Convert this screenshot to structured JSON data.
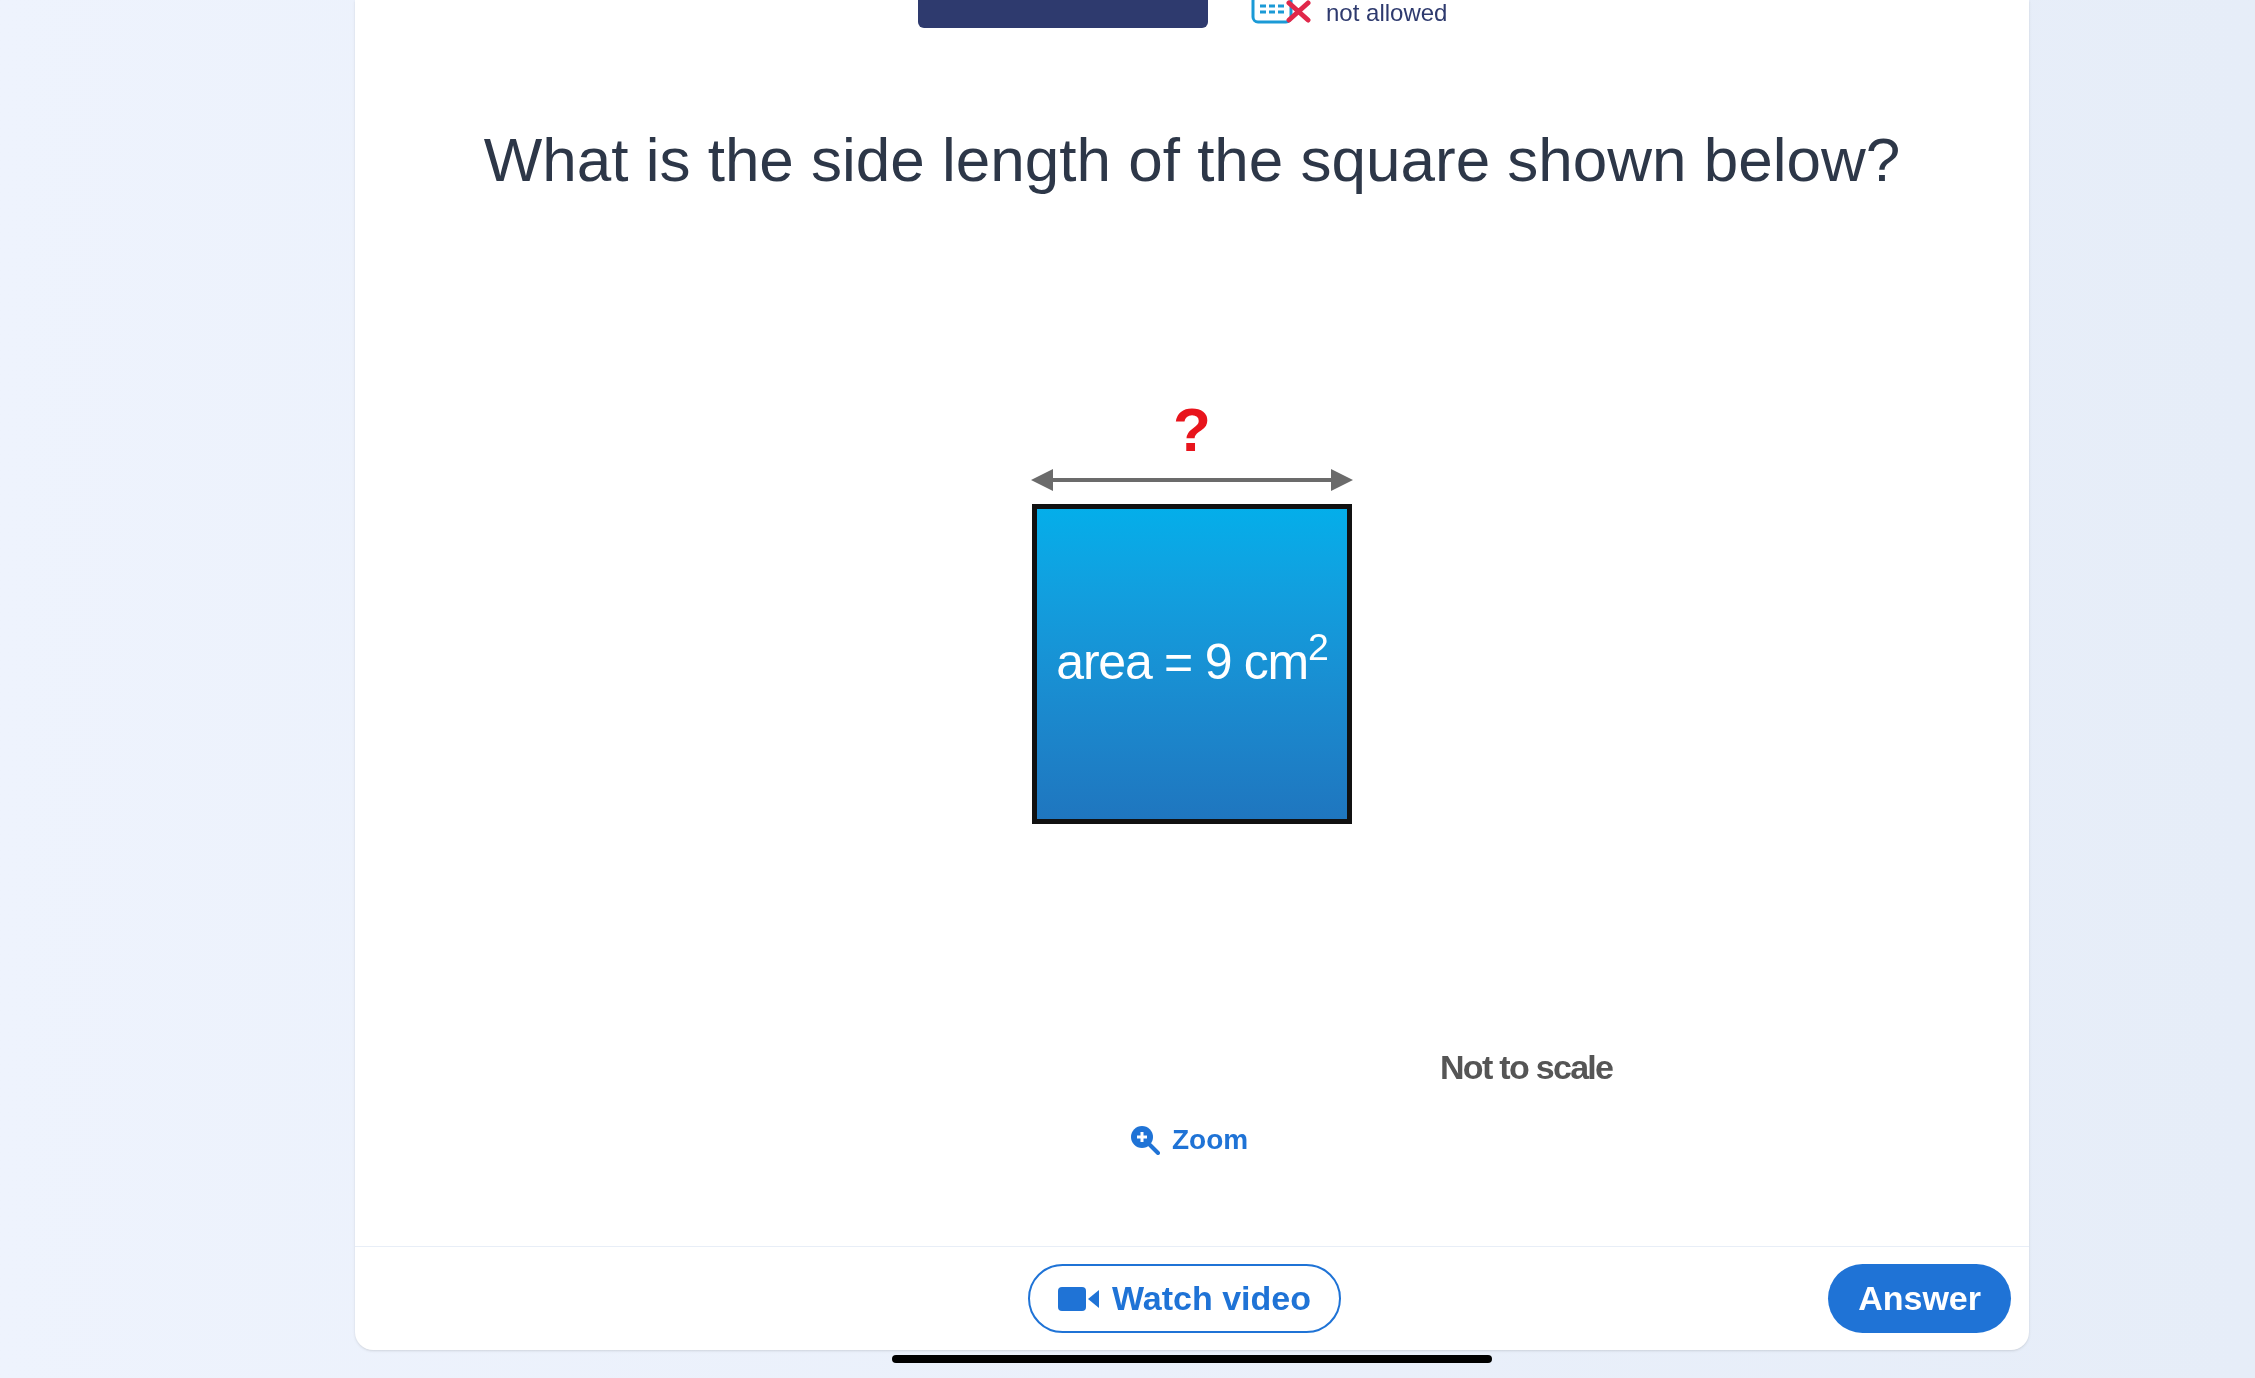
{
  "header": {
    "calculator_status": "not allowed"
  },
  "question": "What is the side length of the square shown below?",
  "figure": {
    "side_label": "?",
    "area_label": "area = 9 cm$^{2}$",
    "note": "Not to scale"
  },
  "zoom_link": "Zoom",
  "buttons": [
    {
      "label": "Watch video",
      "kind": "outline"
    },
    {
      "label": "Answer",
      "kind": "primary"
    }
  ]
}
